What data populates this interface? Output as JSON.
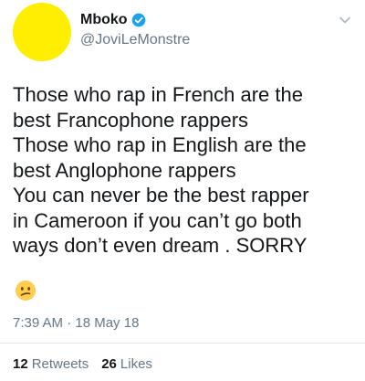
{
  "author": {
    "display_name": "Mboko",
    "handle": "@JoviLeMonstre",
    "verified": true
  },
  "tweet": {
    "lines": [
      "Those who rap in French are the",
      "best Francophone rappers",
      "Those who rap in English are the",
      "best Anglophone rappers",
      "You can never be the best rapper",
      "in Cameroon if you can’t go both",
      "ways don’t even dream . SORRY"
    ],
    "emoji": "confused-face-emoji",
    "timestamp": "7:39 AM · 18 May 18"
  },
  "stats": {
    "retweets_count": "12",
    "retweets_label": "Retweets",
    "likes_count": "26",
    "likes_label": "Likes"
  },
  "colors": {
    "avatar": "#ffee00",
    "verified": "#1da1f2",
    "secondary_text": "#657786"
  }
}
